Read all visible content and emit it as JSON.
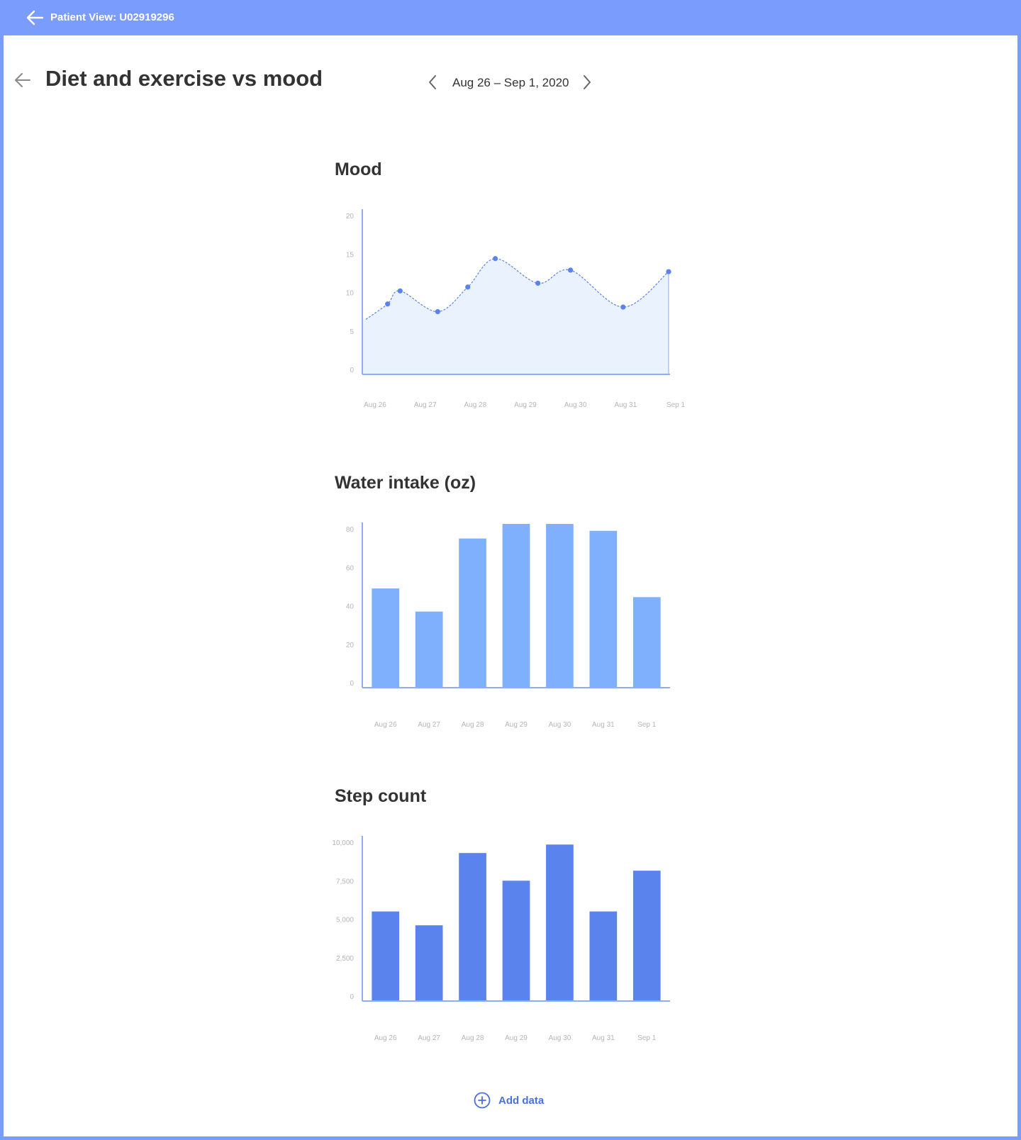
{
  "header": {
    "title": "Patient View: U02919296",
    "back_icon": "arrow-left-icon"
  },
  "page": {
    "title": "Diet and exercise vs mood",
    "back_icon": "arrow-left-icon",
    "date_range": "Aug 26 – Sep 1, 2020",
    "prev_icon": "chevron-left-icon",
    "next_icon": "chevron-right-icon"
  },
  "colors": {
    "header": "#7a9cfd",
    "mood_line": "#5b83ee",
    "mood_fill": "#eaf2fd",
    "water_bar": "#7fb0fd",
    "steps_bar": "#5b83ee",
    "axis": "#8aaefc",
    "tick_text": "#b5b5b5",
    "add_data": "#4a6fe3"
  },
  "add_data": {
    "label": "Add data",
    "icon": "plus-circle-icon"
  },
  "chart_data": [
    {
      "type": "area",
      "title": "Mood",
      "categories": [
        "Aug 26",
        "Aug 27",
        "Aug 28",
        "Aug 29",
        "Aug 30",
        "Aug 31",
        "Sep 1"
      ],
      "x": [
        0.25,
        0.5,
        1.25,
        1.85,
        2.4,
        3.25,
        3.9,
        4.95,
        6.1
      ],
      "values": [
        8.5,
        10.2,
        7.5,
        10.7,
        14.4,
        11.2,
        12.9,
        8.1,
        12.7
      ],
      "line_start": 6.5,
      "yticks": [
        "0",
        "5",
        "10",
        "15",
        "20"
      ],
      "ylim": [
        0,
        20
      ],
      "grid": false,
      "line_style": "dashed"
    },
    {
      "type": "bar",
      "title": "Water intake (oz)",
      "categories": [
        "Aug 26",
        "Aug 27",
        "Aug 28",
        "Aug 29",
        "Aug 30",
        "Aug 31",
        "Sep 1"
      ],
      "values": [
        49,
        37,
        75,
        83.5,
        83.5,
        79,
        44.5
      ],
      "yticks": [
        "0",
        "20",
        "40",
        "60",
        "80"
      ],
      "ylim": [
        0,
        80
      ],
      "grid": false
    },
    {
      "type": "bar",
      "title": "Step count",
      "categories": [
        "Aug 26",
        "Aug 27",
        "Aug 28",
        "Aug 29",
        "Aug 30",
        "Aug 31",
        "Sep 1"
      ],
      "values": [
        5500,
        4600,
        9300,
        7500,
        9850,
        5500,
        8150
      ],
      "yticks": [
        "0",
        "2,500",
        "5,000",
        "7,500",
        "10,000"
      ],
      "ylim": [
        0,
        10000
      ],
      "grid": false
    }
  ]
}
